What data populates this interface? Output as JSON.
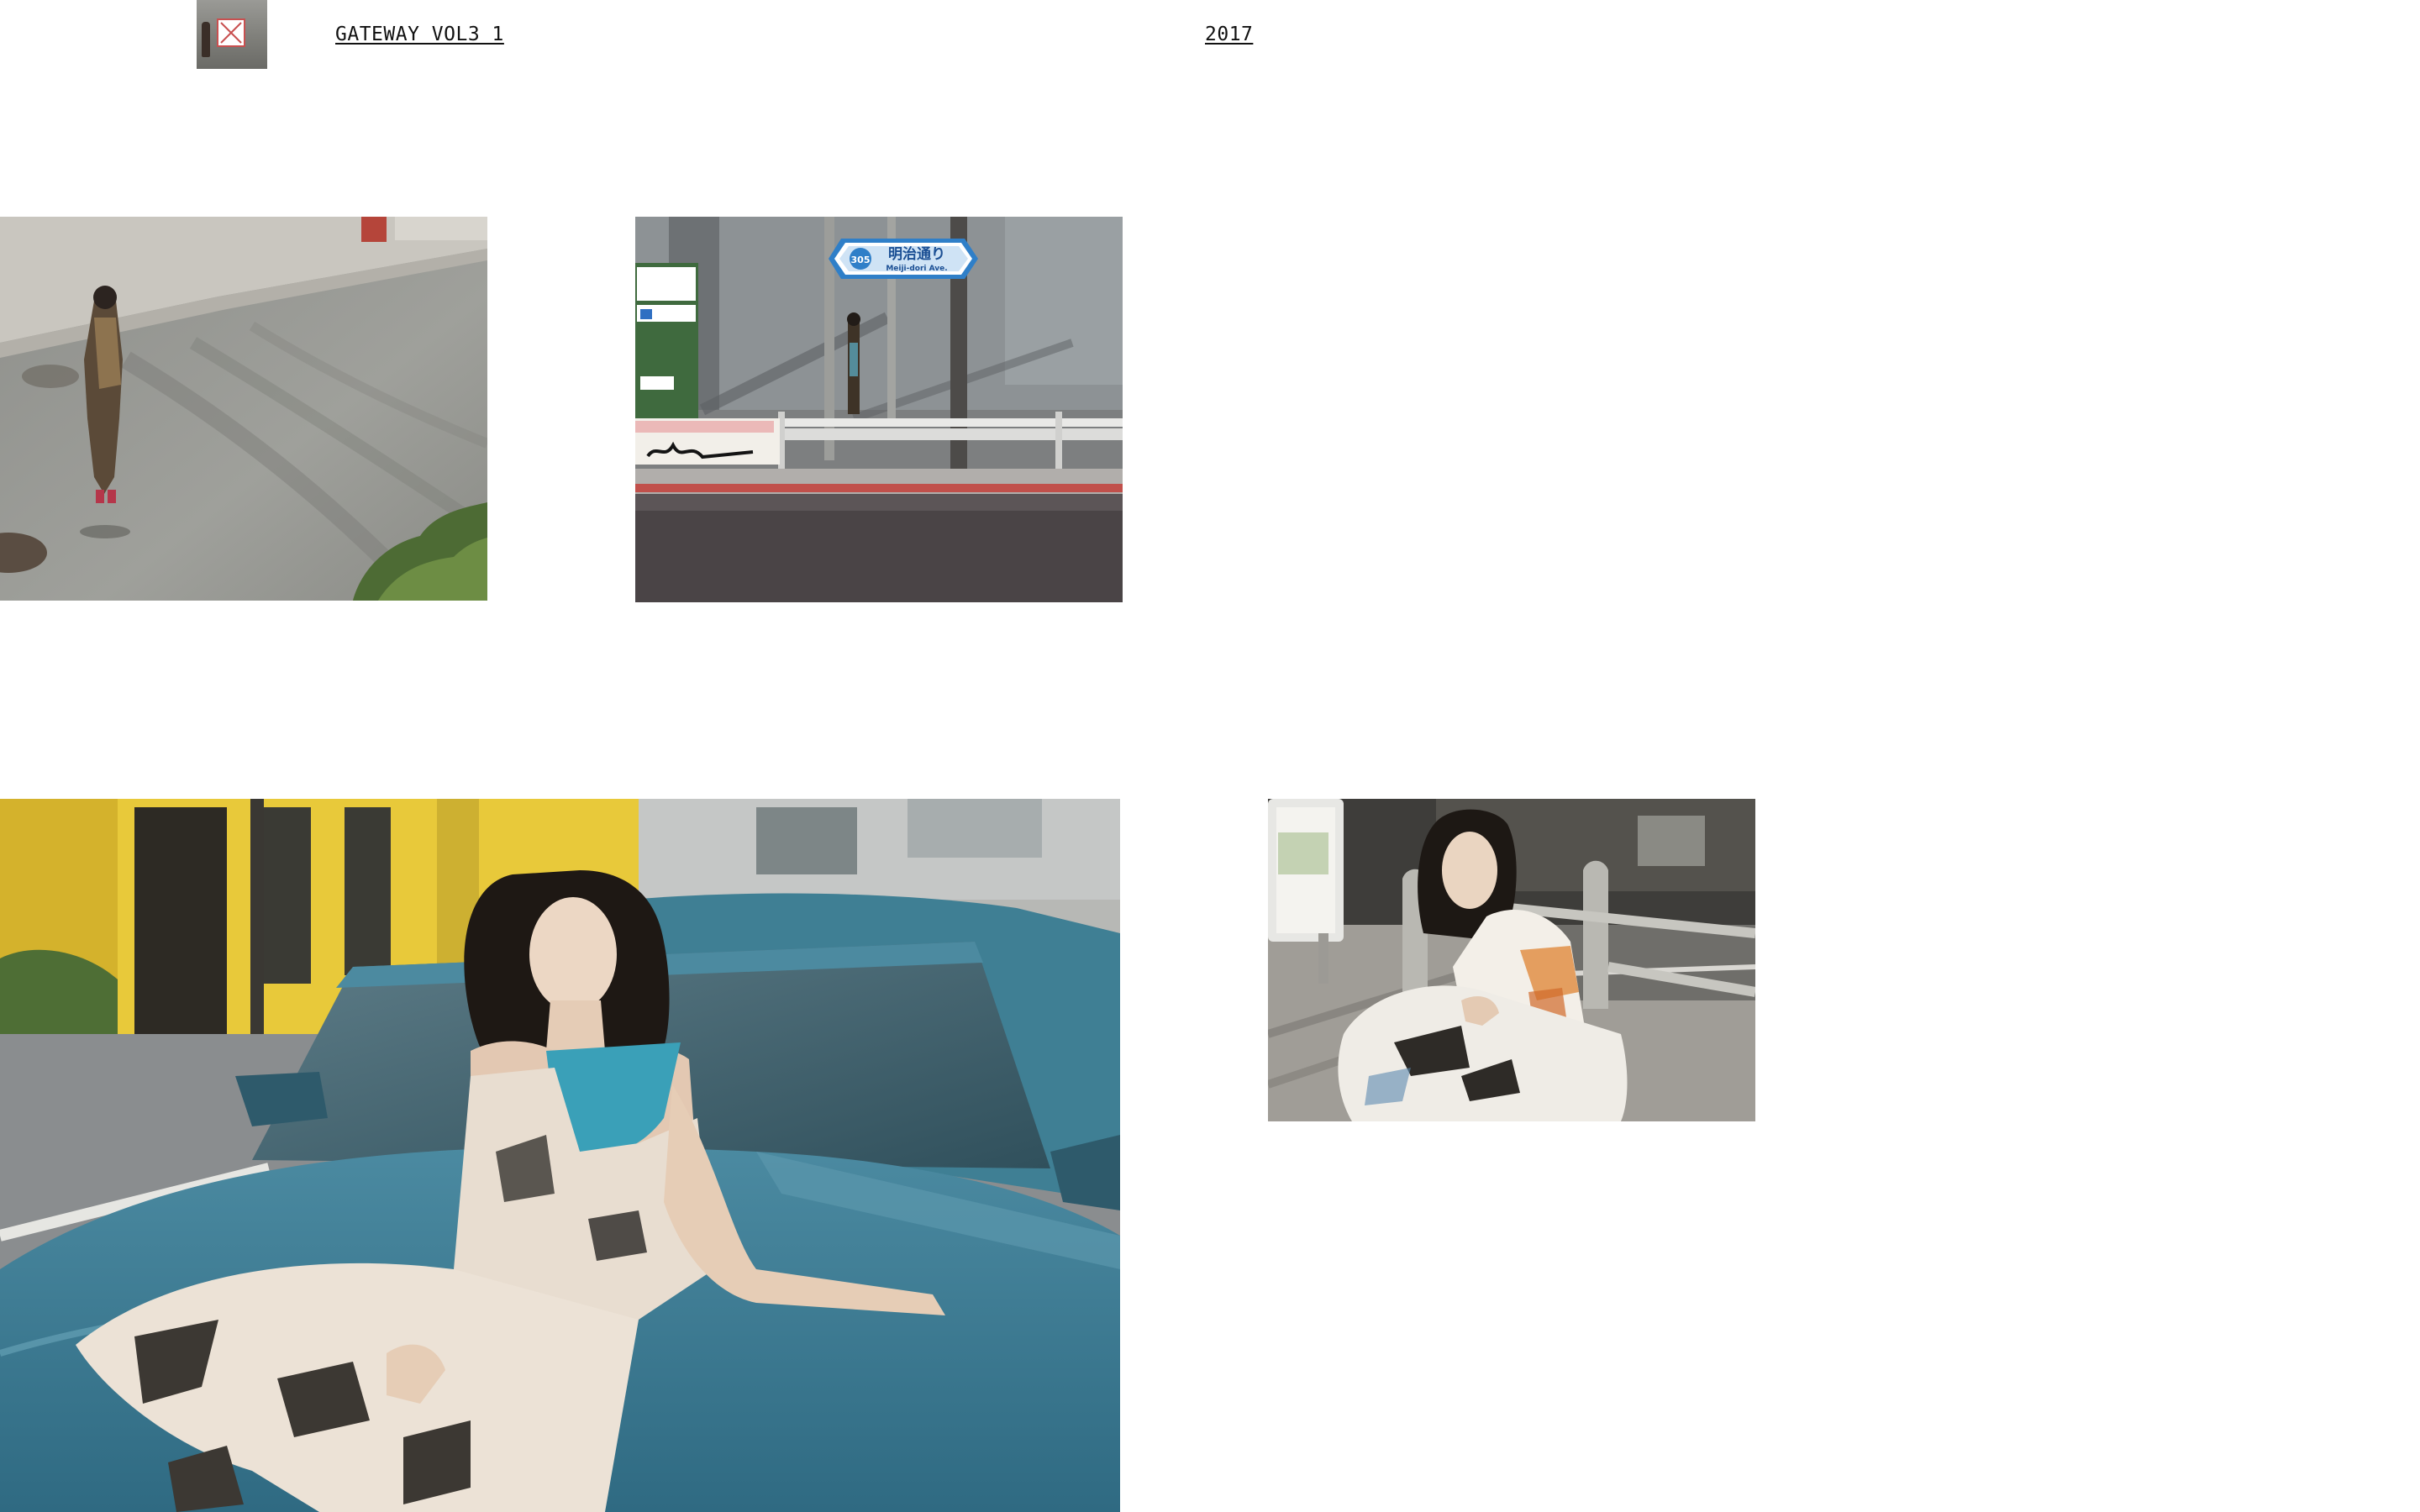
{
  "header": {
    "title": "GATEWAY VOL3 1",
    "year": "2017",
    "thumbnail_icon": "broken-image-icon"
  },
  "sign": {
    "route_number": "305",
    "name_jp": "明治通り",
    "name_en": "Meiji-dori Ave."
  },
  "colors": {
    "background": "#ffffff",
    "text": "#111111",
    "wall_yellow": "#e8c93a",
    "car_teal": "#3f7f94",
    "sign_blue": "#2f7fc8"
  }
}
